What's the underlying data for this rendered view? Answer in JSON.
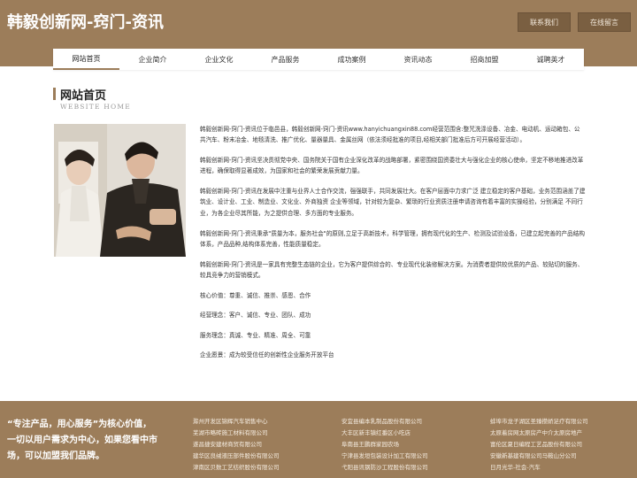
{
  "header": {
    "title": "韩毅创新网-窍门-资讯",
    "contact_button": "联系我们",
    "message_button": "在线留言"
  },
  "nav": {
    "items": [
      "网站首页",
      "企业简介",
      "企业文化",
      "产品服务",
      "成功案例",
      "资讯动态",
      "招商加盟",
      "诚聘英才"
    ],
    "active_index": 0
  },
  "section": {
    "title": "网站首页",
    "subtitle": "WEBSITE HOME"
  },
  "content": {
    "paragraphs": [
      "韩毅创新网-窍门-资讯位于临邑县，韩毅创新网-窍门-资讯www.hanyichuangxin88.com经营范围含:整咒洗涤设备、冶金、电动机、运动箱包、公共汽车、粉末冶金、地毯清洗、推广优化、量器量具、金属丝网（依法须经批准的项目,经相关部门批准后方可开展经营活动）。",
      "韩毅创新网-窍门-资讯坚决贯彻党中央、国务院关于国有企业深化改革的战略部署，紧密围绕国资委壮大与强化企业的核心使命，坚定不移地推进改革进程，确保取得显著成效，为国家和社会的繁荣发展贡献力量。",
      "韩毅创新网-窍门-资讯在发展中注重与业界人士合作交流，强强联手，共同发展壮大。在客户层面中力求广泛 建立稳定的客户基础，业务范围涵盖了建筑业、设计业、工业、制造业、文化业、外商独资 企业等领域，针对较为复杂、繁琐的行业资质注册申请咨询有着丰富的实操经验，分别满足 不同行业，为各企业尽其所能，为之提供合理、多方面的专业服务。",
      "韩毅创新网-窍门-资讯秉承\"质量为本，服务社会\"的原则,立足于高新技术，科学管理，拥有现代化的生产、检测及试验设备，已建立起完善的产品结构体系，产品品种,结构体系完善，性能质量稳定。",
      "韩毅创新网-窍门-资讯是一家具有完整生态链的企业，它为客户提供综合的、专业现代化装修解决方案。为消费者提供较优质的产品、较贴切的服务、较具竞争力的营销模式。"
    ],
    "values": [
      "核心价值：尊重、诚信、推崇、感恩、合作",
      "经营理念：客户、诚信、专业、团队、成功",
      "服务理念：真诚、专业、精准、周全、可靠",
      "企业愿景：成为较受信任的创新性企业服务开放平台"
    ]
  },
  "footer": {
    "slogan": "“专注产品，用心服务”为核心价值，一切以用户需求为中心，如果您看中市场，可以加盟我们品牌。",
    "links_col1": [
      "滁州开发区锦辉汽车销售中心",
      "芜湖市略砖施工材料有限公司",
      "遂昌捷安建材商贸有限公司",
      "建华区良绒液压部件股份有限公司",
      "津南区贝数工艺纺织股份有限公司"
    ],
    "links_col2": [
      "安宜县编本乳制品股份有限公司",
      "大丰区新丰镇红番区小吃店",
      "阜南县王鹏群家园农场",
      "宁津县发垣包装设计加工有限公司",
      "弋阳县讯钢防沙工程股份有限公司"
    ],
    "links_col3": [
      "蚌埠市龙子湖区圣臻攒娇足疗有限公司",
      "太原着房网太原房产中介太原房地产",
      "富伦区夏日编程工艺品股份有限公司",
      "安徽新基建有限公司马鞍山分公司",
      "日月光华-社会-汽车"
    ]
  },
  "colors": {
    "brand": "#9c7d5a",
    "button": "#7a5f41"
  }
}
